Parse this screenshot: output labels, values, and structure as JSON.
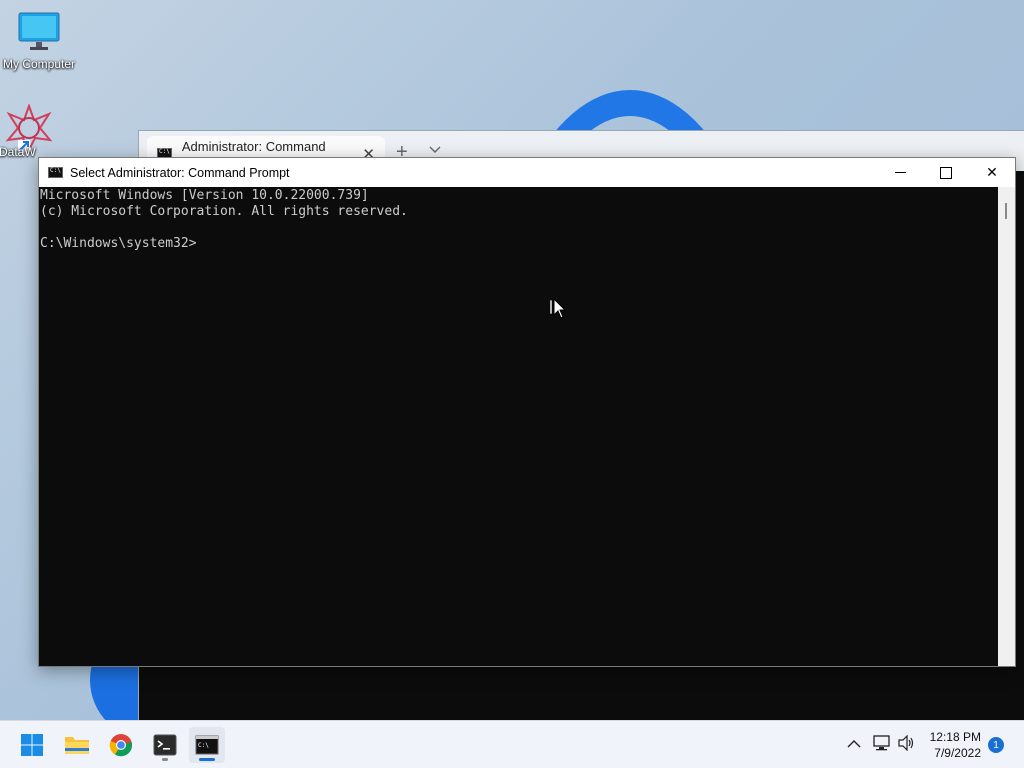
{
  "desktop": {
    "icons": [
      {
        "label": "My Computer"
      },
      {
        "label": "DataW"
      }
    ]
  },
  "terminal": {
    "tab_title": "Administrator: Command Promı",
    "close_glyph": "✕",
    "add_glyph": "+",
    "dropdown_glyph": "⌄"
  },
  "cmd": {
    "title": "Select Administrator: Command Prompt",
    "close_glyph": "✕",
    "lines": [
      "Microsoft Windows [Version 10.0.22000.739]",
      "(c) Microsoft Corporation. All rights reserved.",
      "",
      "C:\\Windows\\system32>"
    ]
  },
  "taskbar": {
    "time": "12:18 PM",
    "date": "7/9/2022",
    "notification_count": "1",
    "chevron_glyph": "∧"
  },
  "colors": {
    "accent": "#1a73e8",
    "console_bg": "#0c0c0c",
    "console_text": "#cccccc"
  }
}
